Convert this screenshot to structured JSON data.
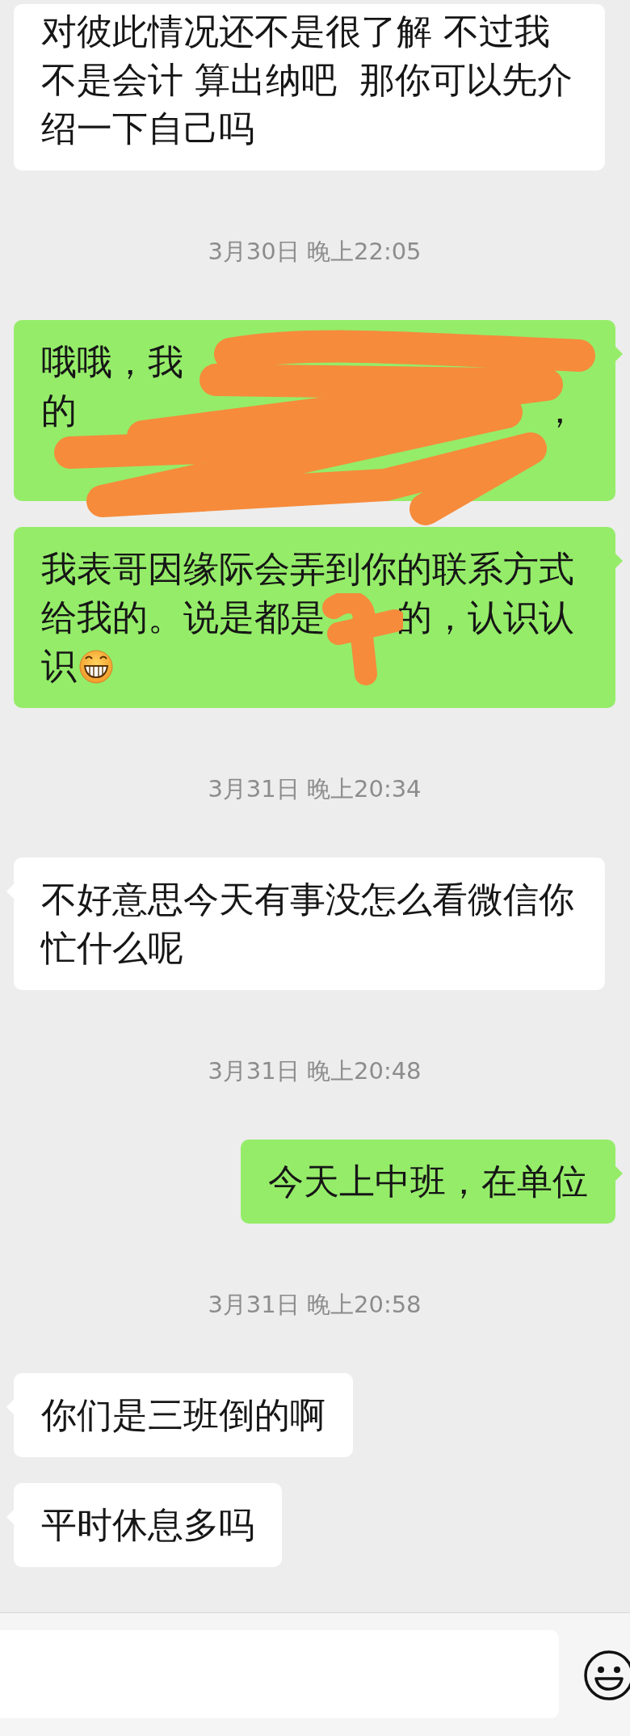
{
  "messages": [
    {
      "kind": "text",
      "outgoing": false,
      "tail": false,
      "text": "对彼此情况还不是很了解 不过我不是会计 算出纳吧  那你可以先介绍一下自己吗"
    },
    {
      "kind": "time",
      "text": "3月30日 晚上22:05"
    },
    {
      "kind": "redacted",
      "outgoing": true,
      "tail": true,
      "lines": [
        {
          "left": "哦哦，我"
        },
        {
          "left": "的",
          "right": "，"
        }
      ]
    },
    {
      "kind": "partly_redacted",
      "outgoing": true,
      "tail": true,
      "lines": [
        {
          "left": "我表哥因缘际会弄到你的联系方式"
        },
        {
          "left": "给我的。说是都是",
          "right": "的，认识认"
        },
        {
          "left": "识",
          "emoji": true
        }
      ]
    },
    {
      "kind": "time",
      "text": "3月31日 晚上20:34"
    },
    {
      "kind": "text",
      "outgoing": false,
      "tail": true,
      "text": "不好意思今天有事没怎么看微信你忙什么呢"
    },
    {
      "kind": "time",
      "text": "3月31日 晚上20:48"
    },
    {
      "kind": "text",
      "outgoing": true,
      "tail": true,
      "text": "今天上中班，在单位"
    },
    {
      "kind": "time",
      "text": "3月31日 晚上20:58"
    },
    {
      "kind": "text",
      "outgoing": false,
      "tail": true,
      "text": "你们是三班倒的啊"
    },
    {
      "kind": "text",
      "outgoing": false,
      "tail": true,
      "text": "平时休息多吗"
    }
  ],
  "input_bar": {
    "emoji_button": true
  }
}
